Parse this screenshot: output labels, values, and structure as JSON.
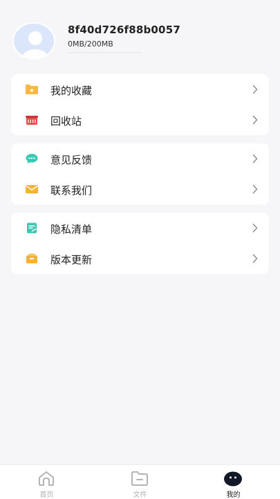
{
  "profile": {
    "username": "8f40d726f88b0057",
    "storage_text": "0MB/200MB",
    "storage_fraction": 0.0
  },
  "menu": {
    "favorites": "我的收藏",
    "recycle_bin": "回收站",
    "feedback": "意见反馈",
    "contact_us": "联系我们",
    "privacy_list": "隐私清单",
    "version_update": "版本更新"
  },
  "icons": {
    "favorites": "folder-star-icon",
    "recycle_bin": "basket-icon",
    "feedback": "chat-bubble-icon",
    "contact_us": "envelope-icon",
    "privacy_list": "document-edit-icon",
    "version_update": "box-icon",
    "chevron": "chevron-right-icon"
  },
  "tabbar": {
    "home": "首页",
    "files": "文件",
    "mine": "我的",
    "active": "mine"
  },
  "colors": {
    "background": "#f6f6f8",
    "card": "#ffffff",
    "folder_yellow": "#f7b946",
    "basket_red": "#e8484a",
    "teal": "#38c9b4",
    "envelope_orange": "#f4b23a",
    "active_tab": "#222222",
    "inactive_tab": "#b3b3b3"
  }
}
